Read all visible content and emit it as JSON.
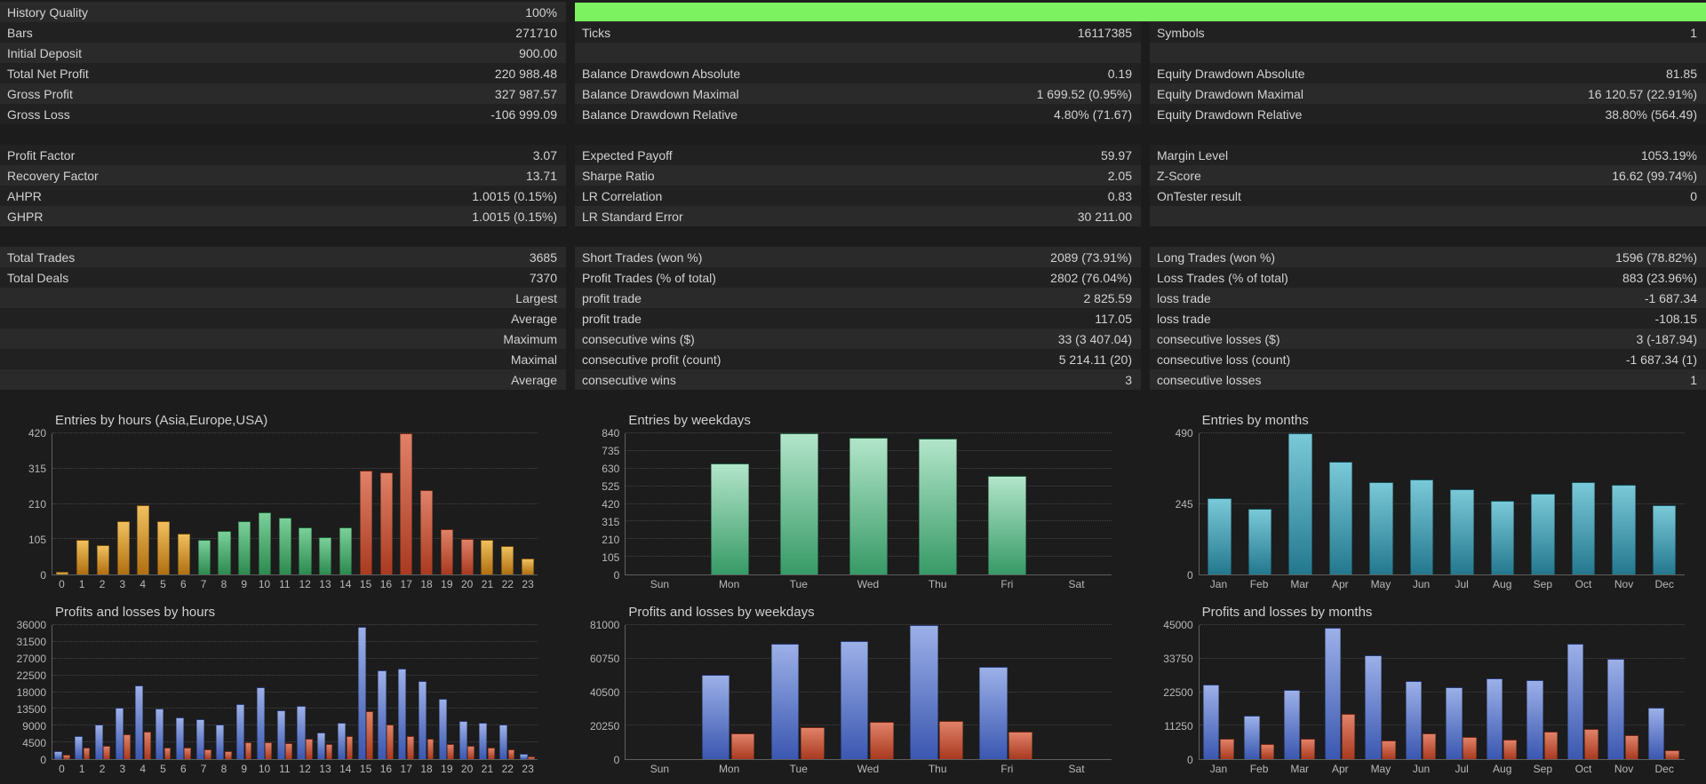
{
  "palette": {
    "ui": {
      "bg": "#1c1c1c",
      "row-a": "#2a2a2a",
      "row-b": "#212121",
      "text": "#d2d2d2",
      "muted": "#b8b8b8",
      "axis": "#5f5f5f",
      "grid": "#454545",
      "progress": "#7df261"
    },
    "bars": {
      "orange": [
        "#f0c05e",
        "#b06f10"
      ],
      "green": [
        "#7bd09a",
        "#2c8a50"
      ],
      "mint": [
        "#b2e5ca",
        "#379a66"
      ],
      "teal": [
        "#7ac9d8",
        "#24788e"
      ],
      "blue": [
        "#9cb0e8",
        "#3b57b0"
      ],
      "red": [
        "#e08168",
        "#a83a20"
      ]
    }
  },
  "table": {
    "rows": [
      {
        "kind": "progress",
        "cells": [
          {
            "l": "History Quality",
            "v": "100%"
          }
        ]
      },
      {
        "cells": [
          {
            "l": "Bars",
            "v": "271710"
          },
          {
            "l": "Ticks",
            "v": "16117385"
          },
          {
            "l": "Symbols",
            "v": "1"
          }
        ]
      },
      {
        "cells": [
          {
            "l": "Initial Deposit",
            "v": "900.00"
          },
          null,
          null
        ]
      },
      {
        "cells": [
          {
            "l": "Total Net Profit",
            "v": "220 988.48"
          },
          {
            "l": "Balance Drawdown Absolute",
            "v": "0.19"
          },
          {
            "l": "Equity Drawdown Absolute",
            "v": "81.85"
          }
        ]
      },
      {
        "cells": [
          {
            "l": "Gross Profit",
            "v": "327 987.57"
          },
          {
            "l": "Balance Drawdown Maximal",
            "v": "1 699.52 (0.95%)"
          },
          {
            "l": "Equity Drawdown Maximal",
            "v": "16 120.57 (22.91%)"
          }
        ]
      },
      {
        "cells": [
          {
            "l": "Gross Loss",
            "v": "-106 999.09"
          },
          {
            "l": "Balance Drawdown Relative",
            "v": "4.80% (71.67)"
          },
          {
            "l": "Equity Drawdown Relative",
            "v": "38.80% (564.49)"
          }
        ]
      },
      {
        "kind": "blank"
      },
      {
        "cells": [
          {
            "l": "Profit Factor",
            "v": "3.07"
          },
          {
            "l": "Expected Payoff",
            "v": "59.97"
          },
          {
            "l": "Margin Level",
            "v": "1053.19%"
          }
        ]
      },
      {
        "cells": [
          {
            "l": "Recovery Factor",
            "v": "13.71"
          },
          {
            "l": "Sharpe Ratio",
            "v": "2.05"
          },
          {
            "l": "Z-Score",
            "v": "16.62 (99.74%)"
          }
        ]
      },
      {
        "cells": [
          {
            "l": "AHPR",
            "v": "1.0015 (0.15%)"
          },
          {
            "l": "LR Correlation",
            "v": "0.83"
          },
          {
            "l": "OnTester result",
            "v": "0"
          }
        ]
      },
      {
        "cells": [
          {
            "l": "GHPR",
            "v": "1.0015 (0.15%)"
          },
          {
            "l": "LR Standard Error",
            "v": "30 211.00"
          },
          null
        ]
      },
      {
        "kind": "blank"
      },
      {
        "cells": [
          {
            "l": "Total Trades",
            "v": "3685"
          },
          {
            "l": "Short Trades (won %)",
            "v": "2089 (73.91%)"
          },
          {
            "l": "Long Trades (won %)",
            "v": "1596 (78.82%)"
          }
        ]
      },
      {
        "cells": [
          {
            "l": "Total Deals",
            "v": "7370"
          },
          {
            "l": "Profit Trades (% of total)",
            "v": "2802 (76.04%)"
          },
          {
            "l": "Loss Trades (% of total)",
            "v": "883 (23.96%)"
          }
        ]
      },
      {
        "cells": [
          {
            "l": "",
            "v": "Largest"
          },
          {
            "l": "profit trade",
            "v": "2 825.59"
          },
          {
            "l": "loss trade",
            "v": "-1 687.34"
          }
        ]
      },
      {
        "cells": [
          {
            "l": "",
            "v": "Average"
          },
          {
            "l": "profit trade",
            "v": "117.05"
          },
          {
            "l": "loss trade",
            "v": "-108.15"
          }
        ]
      },
      {
        "cells": [
          {
            "l": "",
            "v": "Maximum"
          },
          {
            "l": "consecutive wins ($)",
            "v": "33 (3 407.04)"
          },
          {
            "l": "consecutive losses ($)",
            "v": "3 (-187.94)"
          }
        ]
      },
      {
        "cells": [
          {
            "l": "",
            "v": "Maximal"
          },
          {
            "l": "consecutive profit (count)",
            "v": "5 214.11 (20)"
          },
          {
            "l": "consecutive loss (count)",
            "v": "-1 687.34 (1)"
          }
        ]
      },
      {
        "cells": [
          {
            "l": "",
            "v": "Average"
          },
          {
            "l": "consecutive wins",
            "v": "3"
          },
          {
            "l": "consecutive losses",
            "v": "1"
          }
        ]
      }
    ]
  },
  "chart_data": [
    {
      "type": "bar",
      "title": "Entries by hours (Asia,Europe,USA)",
      "categories": [
        "0",
        "1",
        "2",
        "3",
        "4",
        "5",
        "6",
        "7",
        "8",
        "9",
        "10",
        "11",
        "12",
        "13",
        "14",
        "15",
        "16",
        "17",
        "18",
        "19",
        "20",
        "21",
        "22",
        "23"
      ],
      "values": [
        8,
        103,
        88,
        158,
        205,
        158,
        122,
        103,
        130,
        158,
        185,
        168,
        140,
        112,
        140,
        308,
        305,
        420,
        250,
        135,
        105,
        103,
        85,
        48
      ],
      "bar_colors": [
        "orange",
        "orange",
        "orange",
        "orange",
        "orange",
        "orange",
        "orange",
        "green",
        "green",
        "green",
        "green",
        "green",
        "green",
        "green",
        "green",
        "red",
        "red",
        "red",
        "red",
        "red",
        "red",
        "orange",
        "orange",
        "orange"
      ],
      "bar_width_frac": 0.62,
      "yticks": [
        0,
        105,
        210,
        315,
        420
      ],
      "ylim": [
        0,
        420
      ],
      "grid": true,
      "legend": "none"
    },
    {
      "type": "bar",
      "title": "Entries by weekdays",
      "categories": [
        "Sun",
        "Mon",
        "Tue",
        "Wed",
        "Thu",
        "Fri",
        "Sat"
      ],
      "values": [
        0,
        660,
        840,
        812,
        806,
        588,
        0
      ],
      "bar_color": "mint",
      "bar_width_frac": 0.55,
      "yticks": [
        0,
        105,
        210,
        315,
        420,
        525,
        630,
        735,
        840
      ],
      "ylim": [
        0,
        840
      ],
      "grid": true,
      "legend": "none"
    },
    {
      "type": "bar",
      "title": "Entries by months",
      "categories": [
        "Jan",
        "Feb",
        "Mar",
        "Apr",
        "May",
        "Jun",
        "Jul",
        "Aug",
        "Sep",
        "Oct",
        "Nov",
        "Dec"
      ],
      "values": [
        265,
        228,
        490,
        392,
        322,
        330,
        296,
        256,
        282,
        322,
        312,
        240
      ],
      "bar_color": "teal",
      "bar_width_frac": 0.58,
      "yticks": [
        0,
        245,
        490
      ],
      "ylim": [
        0,
        490
      ],
      "grid": true,
      "legend": "none"
    },
    {
      "type": "bar",
      "title": "Profits and losses by hours",
      "categories": [
        "0",
        "1",
        "2",
        "3",
        "4",
        "5",
        "6",
        "7",
        "8",
        "9",
        "10",
        "11",
        "12",
        "13",
        "14",
        "15",
        "16",
        "17",
        "18",
        "19",
        "20",
        "21",
        "22",
        "23"
      ],
      "series": [
        {
          "name": "profit",
          "color": "blue",
          "values": [
            2200,
            6200,
            9200,
            13800,
            19800,
            13500,
            11200,
            10800,
            9200,
            14800,
            19300,
            13200,
            14200,
            7200,
            9800,
            35600,
            23800,
            24400,
            21000,
            16200,
            10200,
            9800,
            9200,
            1400
          ]
        },
        {
          "name": "loss",
          "color": "red",
          "values": [
            1100,
            3100,
            3600,
            6600,
            7400,
            3100,
            3000,
            2600,
            2100,
            4600,
            4600,
            4400,
            5600,
            4100,
            6100,
            12800,
            9400,
            6100,
            5600,
            4100,
            3600,
            3100,
            2600,
            800
          ]
        }
      ],
      "yticks": [
        0,
        4500,
        9000,
        13500,
        18000,
        22500,
        27000,
        31500,
        36000
      ],
      "ylim": [
        0,
        36000
      ],
      "grid": true,
      "legend": "none"
    },
    {
      "type": "bar",
      "title": "Profits and losses by weekdays",
      "categories": [
        "Sun",
        "Mon",
        "Tue",
        "Wed",
        "Thu",
        "Fri",
        "Sat"
      ],
      "series": [
        {
          "name": "profit",
          "color": "blue",
          "values": [
            0,
            51000,
            70000,
            71500,
            81000,
            56000,
            0
          ]
        },
        {
          "name": "loss",
          "color": "red",
          "values": [
            0,
            15500,
            19500,
            22500,
            23200,
            16500,
            0
          ]
        }
      ],
      "yticks": [
        0,
        20250,
        40500,
        60750,
        81000
      ],
      "ylim": [
        0,
        81000
      ],
      "grid": true,
      "legend": "none"
    },
    {
      "type": "bar",
      "title": "Profits and losses by months",
      "categories": [
        "Jan",
        "Feb",
        "Mar",
        "Apr",
        "May",
        "Jun",
        "Jul",
        "Aug",
        "Sep",
        "Oct",
        "Nov",
        "Dec"
      ],
      "series": [
        {
          "name": "profit",
          "color": "blue",
          "values": [
            25000,
            14500,
            23200,
            44200,
            34800,
            26200,
            24200,
            27200,
            26600,
            38800,
            33600,
            17400
          ]
        },
        {
          "name": "loss",
          "color": "red",
          "values": [
            7000,
            5000,
            7000,
            15200,
            6200,
            8600,
            7600,
            6600,
            9200,
            10200,
            8200,
            3100
          ]
        }
      ],
      "yticks": [
        0,
        11250,
        22500,
        33750,
        45000
      ],
      "ylim": [
        0,
        45000
      ],
      "grid": true,
      "legend": "none"
    }
  ]
}
